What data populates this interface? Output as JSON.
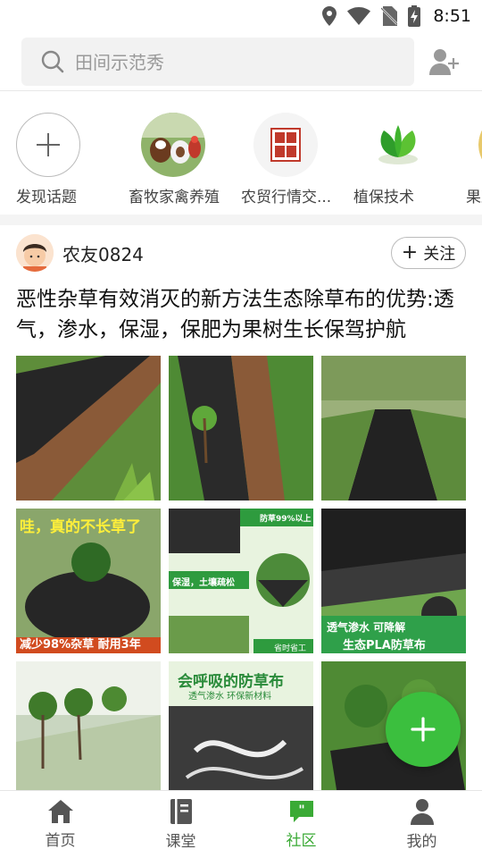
{
  "status_bar": {
    "time": "8:51"
  },
  "search": {
    "placeholder": "田间示范秀"
  },
  "topics": [
    {
      "label": "发现话题"
    },
    {
      "label": "畜牧家禽养殖"
    },
    {
      "label": "农贸行情交..."
    },
    {
      "label": "植保技术"
    },
    {
      "label": "果蔬"
    }
  ],
  "post": {
    "username": "农友0824",
    "follow_label": "关注",
    "title": "恶性杂草有效消灭的新方法生态除草布的优势:透气，渗水，保湿，保肥为果树生长保驾护航",
    "photo_texts": {
      "p4_top": "哇，真的不长草了",
      "p4_bottom": "减少98%杂草 耐用3年",
      "p5_a": "防草99%以上",
      "p5_b": "保湿，土壤疏松",
      "p5_c": "省时省工",
      "p6_a": "透气渗水 可降解",
      "p6_b": "生态PLA防草布",
      "p8_a": "会呼吸的防草布",
      "p8_b": "透气渗水 环保新材料"
    }
  },
  "nav": [
    {
      "label": "首页",
      "active": false
    },
    {
      "label": "课堂",
      "active": false
    },
    {
      "label": "社区",
      "active": true
    },
    {
      "label": "我的",
      "active": false
    }
  ],
  "colors": {
    "accent": "#3bbf3e",
    "nav_active": "#3aaa35"
  }
}
